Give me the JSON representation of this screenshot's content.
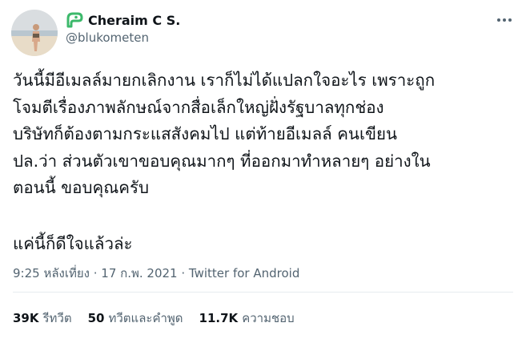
{
  "user": {
    "display_name": "Cheraim C S.",
    "handle": "@blukometen",
    "avatar_icon": "avatar-beach-photo",
    "badge_icon": "green-logo-icon"
  },
  "more_icon": "three-dots-icon",
  "tweet": {
    "lines": [
      "วันนี้มีอีเมลล์มายกเลิกงาน เราก็ไม่ได้แปลกใจอะไร เพราะถูก",
      "โจมตีเรื่องภาพลักษณ์จากสื่อเล็กใหญ่ฝั่งรัฐบาลทุกช่อง",
      "บริษัทก็ต้องตามกระแสสังคมไป แต่ท้ายอีเมลล์ คนเขียน",
      "ปล.ว่า ส่วนตัวเขาขอบคุณมากๆ ที่ออกมาทำหลายๆ อย่างใน",
      "ตอนนี้ ขอบคุณครับ"
    ],
    "final_line": "แค่นี้ก็ดีใจแล้วล่ะ"
  },
  "meta": {
    "time": "9:25 หลังเที่ยง",
    "dot1": " · ",
    "date": "17 ก.พ. 2021",
    "dot2": " · ",
    "source": "Twitter for Android"
  },
  "stats": {
    "retweets": {
      "count": "39K",
      "label": "รีทวีต"
    },
    "quotes": {
      "count": "50",
      "label": "ทวีตและคำพูด"
    },
    "likes": {
      "count": "11.7K",
      "label": "ความชอบ"
    }
  },
  "colors": {
    "text": "#0f1419",
    "secondary": "#536471",
    "logo_green": "#3cb96b",
    "divider": "#e6ecf0"
  }
}
